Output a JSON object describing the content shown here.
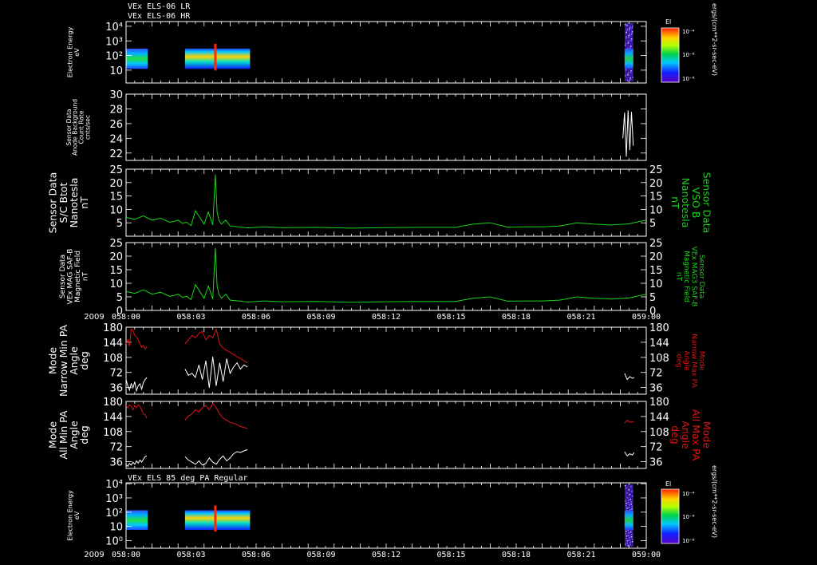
{
  "header": {
    "line1": "VEx ELS-06 LR",
    "line2": "VEx ELS-06 HR"
  },
  "footer_title": "VEx ELS 85 deg PA Regular",
  "time_axis": {
    "year": "2009",
    "ticks": [
      "058:00",
      "058:03",
      "058:06",
      "058:09",
      "058:12",
      "058:15",
      "058:18",
      "058:21",
      "059:00"
    ]
  },
  "colors": {
    "trace_green": "#19d219",
    "trace_red": "#dc1414",
    "trace_white": "#ffffff",
    "axis": "#ffffff",
    "background": "#000000"
  },
  "colorbar": {
    "title": "El",
    "unit_label": "ergs/(cm**2-sr-sec-eV)",
    "ticks": [
      "10⁻⁴",
      "10⁻⁶",
      "10⁻⁸"
    ]
  },
  "chart_data": [
    {
      "type": "heatmap",
      "panel": "electron-energy-lr-hr",
      "ylabel": [
        "Electron Energy",
        "eV"
      ],
      "yscale": "log",
      "yticks": [
        "10",
        "10²",
        "10³",
        "10⁴"
      ],
      "x_range_minutes": [
        0,
        60
      ],
      "segments_minutes": [
        [
          0,
          2.5
        ],
        [
          6.8,
          14.3
        ],
        [
          57.5,
          58.5
        ]
      ]
    },
    {
      "type": "line",
      "panel": "anode-background",
      "ylabel": [
        "Sensor Data",
        "Anode Background",
        "Count Rate",
        "cnts/sec"
      ],
      "ylim": [
        21,
        30
      ],
      "yticks": [
        "22",
        "24",
        "26",
        "28",
        "30"
      ],
      "series": [
        {
          "color": "white",
          "x_minutes": [
            57.3,
            57.5,
            57.7,
            57.9,
            58.1,
            58.3,
            58.5
          ],
          "values": [
            24,
            27.5,
            21.5,
            27.8,
            22.4,
            27.6,
            23
          ]
        }
      ]
    },
    {
      "type": "line",
      "panel": "b-total",
      "ylabel": [
        "Sensor Data",
        "S/C Btot",
        "Nanotesla",
        "nT"
      ],
      "ylabel_right": [
        "Sensor Data",
        "VSO B",
        "Nanotesla",
        "nT"
      ],
      "ylim": [
        0,
        25
      ],
      "yticks": [
        "5",
        "10",
        "15",
        "20",
        "25"
      ],
      "series": [
        {
          "color": "green",
          "x_minutes": [
            0,
            1,
            2,
            3,
            4,
            5,
            5.5,
            6,
            6.5,
            7,
            7.5,
            8,
            8.5,
            9,
            9.5,
            10,
            10.3,
            10.5,
            10.7,
            11,
            11.5,
            12,
            13,
            14,
            16,
            18,
            22,
            26,
            30,
            34,
            38,
            40,
            42,
            44,
            46,
            48,
            50,
            52,
            54,
            56,
            58,
            60
          ],
          "values": [
            7,
            6.3,
            7.6,
            6,
            6.7,
            5.2,
            5.5,
            6,
            4.8,
            5.2,
            4,
            9.5,
            7,
            4.5,
            9,
            4.2,
            23,
            9,
            6,
            4.5,
            6,
            3.8,
            3.5,
            3.1,
            3.5,
            3.2,
            3.3,
            3,
            3.2,
            3.3,
            3.3,
            4.5,
            5,
            3.4,
            3.5,
            3.5,
            3.8,
            5,
            4.5,
            4.2,
            4.6,
            6
          ]
        }
      ]
    },
    {
      "type": "line",
      "panel": "mag-field",
      "ylabel": [
        "Sensor Data",
        "VEx MAG SAF-B",
        "Magnetic Field",
        "nT"
      ],
      "ylabel_right": [
        "Sensor Data",
        "VEx MAG3 SAF-B",
        "Magnetic Field",
        "nT"
      ],
      "ylim": [
        0,
        25
      ],
      "yticks": [
        "0",
        "5",
        "10",
        "15",
        "20",
        "25"
      ],
      "series": [
        {
          "color": "green",
          "x_minutes": [
            0,
            1,
            2,
            3,
            4,
            5,
            5.5,
            6,
            6.5,
            7,
            7.5,
            8,
            8.5,
            9,
            9.5,
            10,
            10.3,
            10.5,
            10.7,
            11,
            11.5,
            12,
            13,
            14,
            16,
            18,
            22,
            26,
            30,
            34,
            38,
            40,
            42,
            44,
            46,
            48,
            50,
            52,
            54,
            56,
            58,
            60
          ],
          "values": [
            7,
            6.3,
            7.6,
            6,
            6.7,
            5.2,
            5.5,
            6,
            4.8,
            5.2,
            4,
            9.5,
            7,
            4.5,
            9,
            4.2,
            23,
            9,
            6,
            4.5,
            6,
            3.8,
            3.5,
            3.1,
            3.5,
            3.2,
            3.3,
            3,
            3.2,
            3.3,
            3.3,
            4.5,
            5,
            3.4,
            3.5,
            3.5,
            3.8,
            5,
            4.5,
            4.2,
            4.6,
            6
          ]
        }
      ]
    },
    {
      "type": "line",
      "panel": "narrow-pa",
      "ylabel": [
        "Mode",
        "Narrow Min PA",
        "Angle",
        "deg"
      ],
      "ylabel_right": [
        "Mode",
        "Narrow Max PA",
        "Angle",
        "deg"
      ],
      "ylim": [
        20,
        180
      ],
      "yticks": [
        "36",
        "72",
        "108",
        "144",
        "180"
      ],
      "series": [
        {
          "color": "red",
          "segments": [
            {
              "x_minutes": [
                0,
                0.2,
                0.4,
                0.6,
                0.8,
                1.0,
                1.2,
                1.4,
                1.6,
                1.8,
                2.0,
                2.2,
                2.4
              ],
              "values": [
                140,
                150,
                135,
                175,
                172,
                160,
                158,
                150,
                140,
                132,
                136,
                128,
                134
              ]
            },
            {
              "x_minutes": [
                6.8,
                7.2,
                7.6,
                8.0,
                8.4,
                8.8,
                9.2,
                9.6,
                10.0,
                10.4,
                10.8,
                11.2,
                11.6,
                12.0,
                12.4,
                12.8,
                13.2,
                13.6,
                14.0
              ],
              "values": [
                140,
                150,
                160,
                155,
                165,
                170,
                150,
                160,
                155,
                175,
                140,
                130,
                125,
                120,
                115,
                110,
                105,
                100,
                95
              ]
            }
          ]
        },
        {
          "color": "white",
          "segments": [
            {
              "x_minutes": [
                0,
                0.2,
                0.4,
                0.6,
                0.8,
                1.0,
                1.2,
                1.4,
                1.6,
                1.8,
                2.0,
                2.2,
                2.4
              ],
              "values": [
                55,
                40,
                30,
                45,
                35,
                50,
                28,
                40,
                45,
                32,
                48,
                55,
                60
              ]
            },
            {
              "x_minutes": [
                6.8,
                7.2,
                7.6,
                8.0,
                8.4,
                8.8,
                9.2,
                9.6,
                10.0,
                10.4,
                10.8,
                11.2,
                11.6,
                12.0,
                12.4,
                12.8,
                13.2,
                13.6,
                14.0
              ],
              "values": [
                80,
                65,
                70,
                60,
                90,
                55,
                100,
                35,
                110,
                40,
                95,
                50,
                105,
                70,
                85,
                95,
                80,
                90,
                85
              ]
            },
            {
              "x_minutes": [
                57.5,
                57.8,
                58.1,
                58.4,
                58.6
              ],
              "values": [
                70,
                55,
                62,
                58,
                60
              ]
            }
          ]
        }
      ]
    },
    {
      "type": "line",
      "panel": "all-pa",
      "ylabel": [
        "Mode",
        "All Min PA",
        "Angle",
        "deg"
      ],
      "ylabel_right": [
        "Mode",
        "All Max PA",
        "Angle",
        "deg"
      ],
      "ylim": [
        20,
        180
      ],
      "yticks": [
        "36",
        "72",
        "108",
        "144",
        "180"
      ],
      "series": [
        {
          "color": "red",
          "segments": [
            {
              "x_minutes": [
                0,
                0.2,
                0.4,
                0.6,
                0.8,
                1.0,
                1.2,
                1.4,
                1.6,
                1.8,
                2.0,
                2.2,
                2.4
              ],
              "values": [
                170,
                165,
                172,
                168,
                160,
                170,
                165,
                172,
                168,
                160,
                150,
                148,
                140
              ]
            },
            {
              "x_minutes": [
                6.8,
                7.2,
                7.6,
                8.0,
                8.4,
                8.8,
                9.2,
                9.6,
                10.0,
                10.4,
                10.8,
                11.2,
                11.6,
                12.0,
                12.4,
                12.8,
                13.2,
                13.6,
                14.0
              ],
              "values": [
                135,
                145,
                150,
                160,
                155,
                165,
                170,
                160,
                175,
                165,
                150,
                140,
                135,
                130,
                128,
                125,
                120,
                118,
                115
              ]
            },
            {
              "x_minutes": [
                57.5,
                57.8,
                58.1,
                58.4,
                58.6
              ],
              "values": [
                128,
                135,
                130,
                132,
                130
              ]
            }
          ]
        },
        {
          "color": "white",
          "segments": [
            {
              "x_minutes": [
                0,
                0.2,
                0.4,
                0.6,
                0.8,
                1.0,
                1.2,
                1.4,
                1.6,
                1.8,
                2.0,
                2.2,
                2.4
              ],
              "values": [
                30,
                25,
                32,
                28,
                35,
                30,
                38,
                33,
                40,
                35,
                42,
                48,
                50
              ]
            },
            {
              "x_minutes": [
                6.8,
                7.2,
                7.6,
                8.0,
                8.4,
                8.8,
                9.2,
                9.6,
                10.0,
                10.4,
                10.8,
                11.2,
                11.6,
                12.0,
                12.4,
                12.8,
                13.2,
                13.6,
                14.0
              ],
              "values": [
                48,
                40,
                35,
                30,
                38,
                28,
                32,
                45,
                35,
                30,
                42,
                50,
                38,
                45,
                55,
                60,
                58,
                62,
                65
              ]
            },
            {
              "x_minutes": [
                57.5,
                57.8,
                58.1,
                58.4,
                58.6
              ],
              "values": [
                60,
                50,
                55,
                52,
                58
              ]
            }
          ]
        }
      ]
    },
    {
      "type": "heatmap",
      "panel": "electron-energy-85deg",
      "ylabel": [
        "Electron Energy",
        "eV"
      ],
      "yscale": "log",
      "yticks": [
        "10⁰",
        "10",
        "10²",
        "10³",
        "10⁴"
      ],
      "x_range_minutes": [
        0,
        60
      ],
      "segments_minutes": [
        [
          0,
          2.5
        ],
        [
          6.8,
          14.3
        ],
        [
          57.5,
          58.5
        ]
      ]
    }
  ]
}
